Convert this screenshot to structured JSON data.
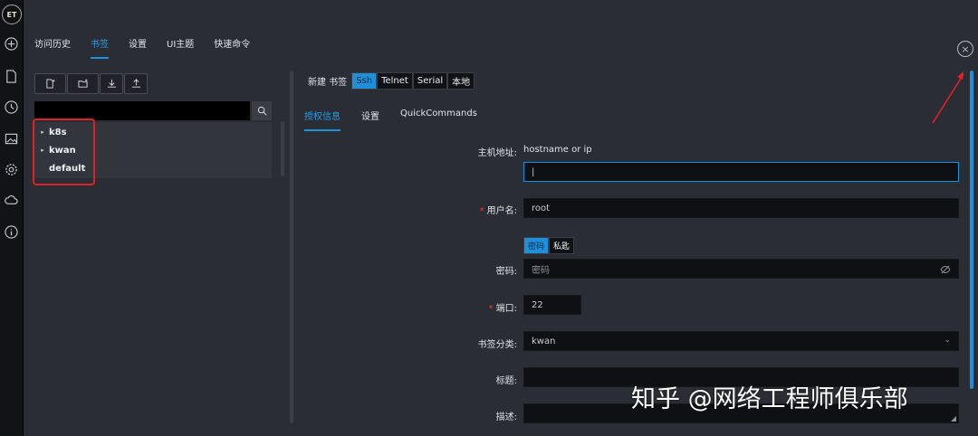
{
  "app": {
    "logo_text": "ET"
  },
  "top_tabs": [
    {
      "label": "访问历史"
    },
    {
      "label": "书签"
    },
    {
      "label": "设置"
    },
    {
      "label": "UI主题"
    },
    {
      "label": "快速命令"
    }
  ],
  "active_top_tab": "书签",
  "tree": {
    "items": [
      {
        "label": "k8s",
        "expandable": true
      },
      {
        "label": "kwan",
        "expandable": true
      },
      {
        "label": "default",
        "expandable": false
      }
    ]
  },
  "form": {
    "new_bookmark_label": "新建 书签",
    "protocols": [
      "Ssh",
      "Telnet",
      "Serial",
      "本地"
    ],
    "active_protocol": "Ssh",
    "subtabs": [
      "授权信息",
      "设置",
      "QuickCommands"
    ],
    "active_subtab": "授权信息",
    "host": {
      "label": "主机地址:",
      "hint": "hostname or ip",
      "value": "|"
    },
    "username": {
      "label": "用户名:",
      "value": "root"
    },
    "auth_types": [
      "密码",
      "私匙"
    ],
    "active_auth": "密码",
    "password": {
      "label": "密码:",
      "placeholder": "密码"
    },
    "port": {
      "label": "端口:",
      "value": "22"
    },
    "category": {
      "label": "书签分类:",
      "value": "kwan"
    },
    "title": {
      "label": "标题:",
      "value": ""
    },
    "description": {
      "label": "描述:",
      "value": ""
    }
  },
  "watermark": "知乎 @网络工程师俱乐部",
  "colors": {
    "accent": "#1e8fd8",
    "highlight": "#e0202a",
    "background": "#2a2d33"
  }
}
